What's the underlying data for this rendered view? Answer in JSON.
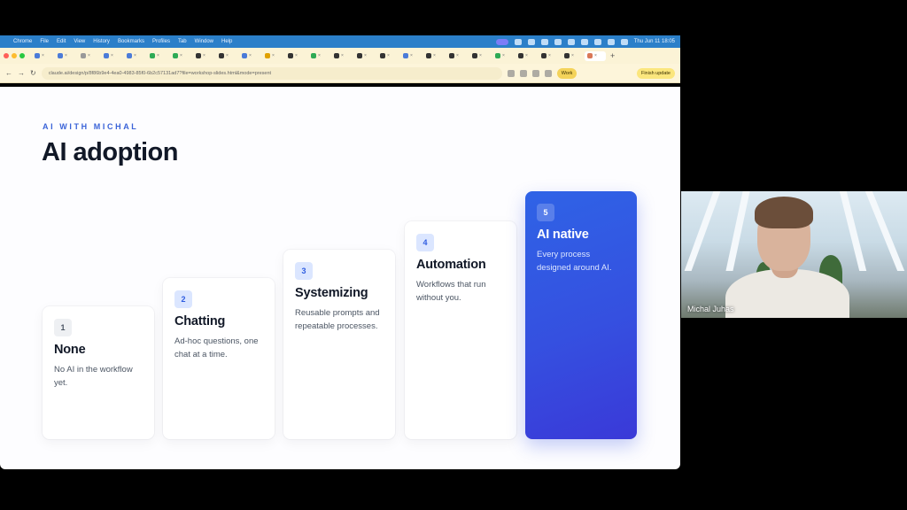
{
  "menubar": {
    "items": [
      "Chrome",
      "File",
      "Edit",
      "View",
      "History",
      "Bookmarks",
      "Profiles",
      "Tab",
      "Window",
      "Help"
    ],
    "clock": "Thu Jun 11 18:05"
  },
  "browser": {
    "url": "claude.ai/design/p/8f86b9e4-4ea0-4983-85f0-6b2c57131ad7?file=workshop-slides.html&mode=present",
    "work_label": "Work",
    "update_label": "Finish update"
  },
  "slide": {
    "eyebrow": "AI WITH MICHAL",
    "title": "AI adoption",
    "stages": [
      {
        "number": "1",
        "name": "None",
        "description": "No AI in the workflow yet."
      },
      {
        "number": "2",
        "name": "Chatting",
        "description": "Ad-hoc questions, one chat at a time."
      },
      {
        "number": "3",
        "name": "Systemizing",
        "description": "Reusable prompts and repeatable processes."
      },
      {
        "number": "4",
        "name": "Automation",
        "description": "Workflows that run without you."
      },
      {
        "number": "5",
        "name": "AI native",
        "description": "Every process designed around AI."
      }
    ]
  },
  "video": {
    "participant_name": "Michal Juhas"
  },
  "colors": {
    "accent": "#3a63d8",
    "native_card": "#2f63e6",
    "menubar": "#2b7fc9"
  }
}
